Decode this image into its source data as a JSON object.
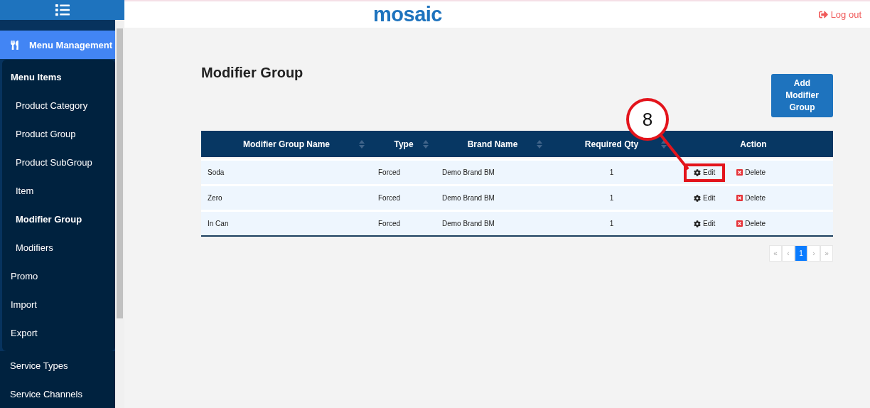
{
  "header": {
    "logo": "mosaic",
    "logout": "Log out"
  },
  "sidebar": {
    "items": [
      {
        "label": "Menu Management",
        "selected": true,
        "expanded": true,
        "children": [
          {
            "label": "Menu Items",
            "kind": "heading",
            "children": [
              {
                "label": "Product Category",
                "selected": false
              },
              {
                "label": "Product Group",
                "selected": false
              },
              {
                "label": "Product SubGroup",
                "selected": false
              },
              {
                "label": "Item",
                "selected": false
              },
              {
                "label": "Modifier Group",
                "selected": true
              },
              {
                "label": "Modifiers",
                "selected": false
              }
            ]
          },
          {
            "label": "Promo",
            "kind": "link"
          },
          {
            "label": "Import",
            "kind": "link"
          },
          {
            "label": "Export",
            "kind": "link"
          }
        ]
      },
      {
        "label": "Service Types",
        "selected": false,
        "expanded": false
      },
      {
        "label": "Service Channels",
        "selected": false,
        "expanded": false
      }
    ]
  },
  "page": {
    "title": "Modifier Group",
    "add_button": "Add Modifier Group"
  },
  "table": {
    "columns": [
      {
        "label": "Modifier Group Name",
        "sortable": true
      },
      {
        "label": "Type",
        "sortable": true
      },
      {
        "label": "Brand Name",
        "sortable": true
      },
      {
        "label": "Required Qty",
        "sortable": true
      },
      {
        "label": "Action",
        "sortable": false
      }
    ],
    "rows": [
      {
        "name": "Soda",
        "type": "Forced",
        "brand": "Demo Brand BM",
        "qty": "1",
        "edit": "Edit",
        "delete": "Delete",
        "highlighted": true
      },
      {
        "name": "Zero",
        "type": "Forced",
        "brand": "Demo Brand BM",
        "qty": "1",
        "edit": "Edit",
        "delete": "Delete",
        "highlighted": false
      },
      {
        "name": "In Can",
        "type": "Forced",
        "brand": "Demo Brand BM",
        "qty": "1",
        "edit": "Edit",
        "delete": "Delete",
        "highlighted": false
      }
    ]
  },
  "pagination": [
    {
      "label": "«",
      "selected": false
    },
    {
      "label": "‹",
      "selected": false
    },
    {
      "label": "1",
      "selected": true
    },
    {
      "label": "›",
      "selected": false
    },
    {
      "label": "»",
      "selected": false
    }
  ],
  "annotation": {
    "label": "8"
  }
}
